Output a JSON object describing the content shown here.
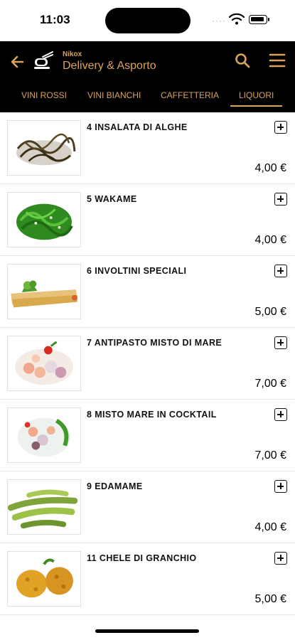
{
  "status": {
    "time": "11:03",
    "dots": "····"
  },
  "header": {
    "brand_small": "Nikox",
    "title": "Delivery & Asporto"
  },
  "tabs": [
    {
      "label": "VINI ROSSI",
      "active": false
    },
    {
      "label": "VINI BIANCHI",
      "active": false
    },
    {
      "label": "CAFFETTERIA",
      "active": false
    },
    {
      "label": "LIQUORI",
      "active": true
    }
  ],
  "items": [
    {
      "name": "4 INSALATA DI ALGHE",
      "price": "4,00 €",
      "image": "seaweed-salad-dark"
    },
    {
      "name": "5 WAKAME",
      "price": "4,00 €",
      "image": "wakame-green"
    },
    {
      "name": "6 INVOLTINI SPECIALI",
      "price": "5,00 €",
      "image": "spring-rolls"
    },
    {
      "name": "7 ANTIPASTO MISTO DI MARE",
      "price": "7,00 €",
      "image": "seafood-platter"
    },
    {
      "name": "8 MISTO MARE IN COCKTAIL",
      "price": "7,00 €",
      "image": "seafood-cocktail"
    },
    {
      "name": "9 EDAMAME",
      "price": "4,00 €",
      "image": "edamame"
    },
    {
      "name": "11 CHELE DI GRANCHIO",
      "price": "5,00 €",
      "image": "crab-claws"
    }
  ],
  "colors": {
    "accent": "#d9a35a",
    "header_bg": "#000000"
  }
}
